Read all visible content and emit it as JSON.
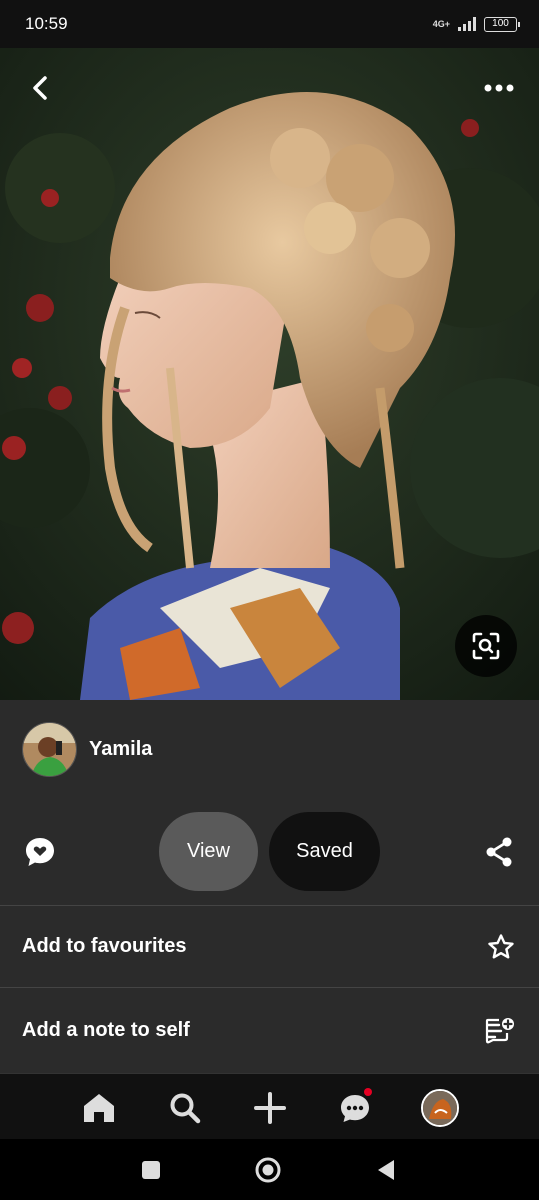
{
  "status_bar": {
    "time": "10:59",
    "network": "4G+",
    "battery": "100"
  },
  "pin": {
    "image_alt": "Woman with curly updo hairstyle in profile",
    "back_icon": "chevron-left-icon",
    "more_icon": "more-horizontal-icon",
    "lens_icon": "visual-search-icon"
  },
  "creator": {
    "name": "Yamila"
  },
  "actions": {
    "view_label": "View",
    "saved_label": "Saved",
    "comment_icon": "comment-heart-icon",
    "share_icon": "share-icon"
  },
  "options": [
    {
      "label": "Add to favourites",
      "icon": "star-icon"
    },
    {
      "label": "Add a note to self",
      "icon": "note-add-icon"
    }
  ],
  "bottom_nav": {
    "items": [
      "home-icon",
      "search-icon",
      "plus-icon",
      "messages-icon",
      "profile-avatar"
    ],
    "notification_color": "#e60023"
  },
  "colors": {
    "panel_bg": "#2b2b2b",
    "saved_bg": "#111111",
    "view_bg": "#5a5a5a"
  }
}
